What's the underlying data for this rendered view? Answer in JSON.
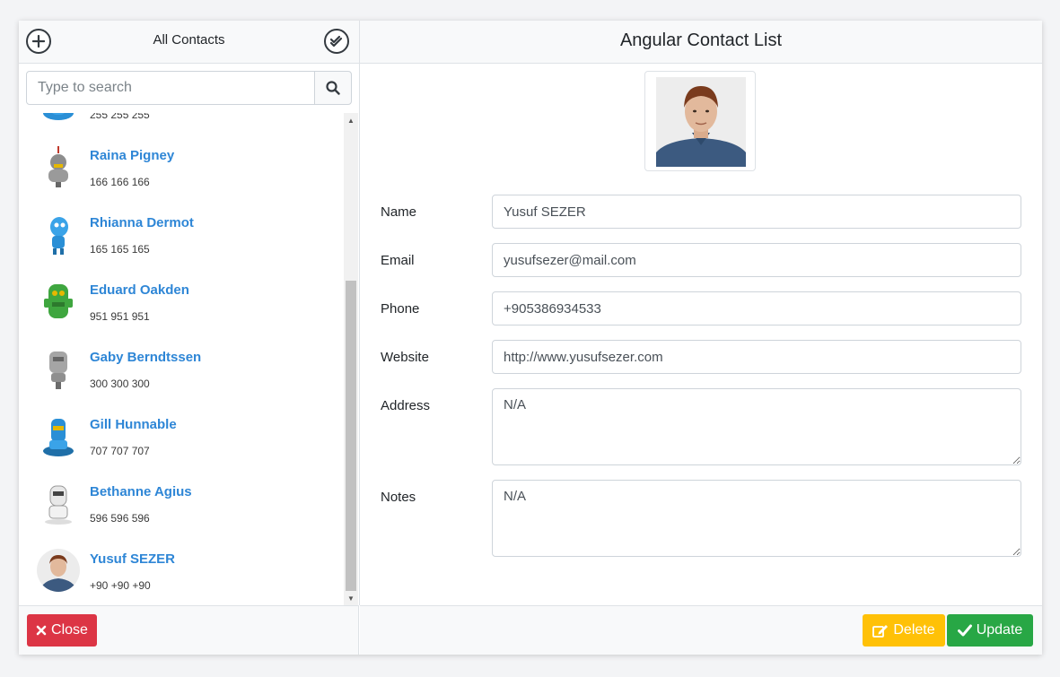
{
  "left_header": {
    "title": "All Contacts",
    "add_icon": "plus-circle-icon",
    "select_all_icon": "double-check-circle-icon"
  },
  "search": {
    "placeholder": "Type to search",
    "icon": "search-icon"
  },
  "contacts": [
    {
      "name": "",
      "phone": "255 255 255",
      "avatar": "blue-robot-avatar",
      "partial": true
    },
    {
      "name": "Raina Pigney",
      "phone": "166 166 166",
      "avatar": "grey-robot-avatar"
    },
    {
      "name": "Rhianna Dermot",
      "phone": "165 165 165",
      "avatar": "blue-robot-avatar"
    },
    {
      "name": "Eduard Oakden",
      "phone": "951 951 951",
      "avatar": "green-robot-avatar"
    },
    {
      "name": "Gaby Berndtssen",
      "phone": "300 300 300",
      "avatar": "grey-robot-avatar"
    },
    {
      "name": "Gill Hunnable",
      "phone": "707 707 707",
      "avatar": "blue-robot-avatar"
    },
    {
      "name": "Bethanne Agius",
      "phone": "596 596 596",
      "avatar": "white-robot-avatar"
    },
    {
      "name": "Yusuf SEZER",
      "phone": "+90 +90 +90",
      "avatar": "person-photo-avatar"
    }
  ],
  "right_header": {
    "title": "Angular Contact List"
  },
  "form": {
    "name_label": "Name",
    "name_value": "Yusuf SEZER",
    "email_label": "Email",
    "email_value": "yusufsezer@mail.com",
    "phone_label": "Phone",
    "phone_value": "+905386934533",
    "website_label": "Website",
    "website_value": "http://www.yusufsezer.com",
    "address_label": "Address",
    "address_value": "N/A",
    "notes_label": "Notes",
    "notes_value": "N/A"
  },
  "footer": {
    "close_label": "Close",
    "close_icon": "times-icon",
    "delete_label": "Delete",
    "delete_icon": "edit-icon",
    "update_label": "Update",
    "update_icon": "check-icon"
  },
  "colors": {
    "link": "#2e86d6",
    "danger": "#dc3545",
    "warning": "#ffc107",
    "success": "#28a745"
  }
}
